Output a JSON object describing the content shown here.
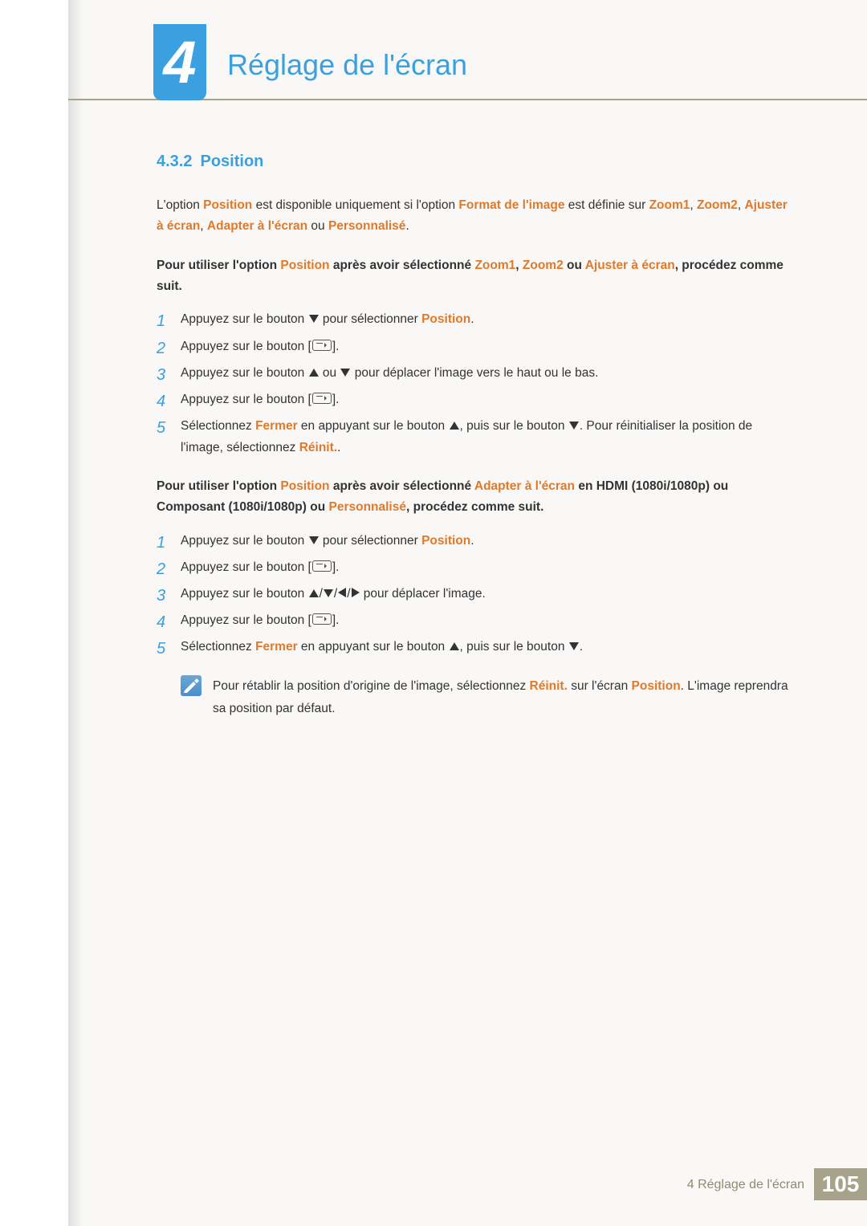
{
  "chapter": {
    "number": "4",
    "title": "Réglage de l'écran"
  },
  "section": {
    "number": "4.3.2",
    "title": "Position"
  },
  "intro": {
    "p1a": "L'option ",
    "p1b": "Position",
    "p1c": " est disponible uniquement si l'option ",
    "p1d": "Format de l'image",
    "p1e": " est définie sur ",
    "p1f": "Zoom1",
    "p1g": ", ",
    "p1h": "Zoom2",
    "p1i": ", ",
    "p1j": "Ajuster à écran",
    "p1k": ", ",
    "p1l": "Adapter à l'écran",
    "p1m": " ou ",
    "p1n": "Personnalisé",
    "p1o": "."
  },
  "lead1": {
    "a": "Pour utiliser l'option ",
    "b": "Position",
    "c": " après avoir sélectionné ",
    "d": "Zoom1",
    "e": ", ",
    "f": "Zoom2",
    "g": " ou ",
    "h": "Ajuster à écran",
    "i": ", procédez comme suit."
  },
  "steps1": {
    "n1": "1",
    "n2": "2",
    "n3": "3",
    "n4": "4",
    "n5": "5",
    "s1a": "Appuyez sur le bouton ",
    "s1b": " pour sélectionner ",
    "s1c": "Position",
    "s1d": ".",
    "s2a": "Appuyez sur le bouton [",
    "s2b": "].",
    "s3a": "Appuyez sur le bouton ",
    "s3b": " ou ",
    "s3c": " pour déplacer l'image vers le haut ou le bas.",
    "s4a": "Appuyez sur le bouton [",
    "s4b": "].",
    "s5a": "Sélectionnez ",
    "s5b": "Fermer",
    "s5c": " en appuyant sur le bouton ",
    "s5d": ", puis sur le bouton ",
    "s5e": ". Pour réinitialiser la position de l'image, sélectionnez ",
    "s5f": "Réinit.",
    "s5g": "."
  },
  "lead2": {
    "a": "Pour utiliser l'option ",
    "b": "Position",
    "c": " après avoir sélectionné ",
    "d": "Adapter à l'écran",
    "e": " en HDMI (1080i/1080p) ou Composant (1080i/1080p) ou ",
    "f": "Personnalisé",
    "g": ", procédez comme suit."
  },
  "steps2": {
    "n1": "1",
    "n2": "2",
    "n3": "3",
    "n4": "4",
    "n5": "5",
    "s1a": "Appuyez sur le bouton ",
    "s1b": " pour sélectionner ",
    "s1c": "Position",
    "s1d": ".",
    "s2a": "Appuyez sur le bouton [",
    "s2b": "].",
    "s3a": "Appuyez sur le bouton ",
    "s3b": " pour déplacer l'image.",
    "s4a": "Appuyez sur le bouton [",
    "s4b": "].",
    "s5a": "Sélectionnez ",
    "s5b": "Fermer",
    "s5c": " en appuyant sur le bouton ",
    "s5d": ", puis sur le bouton ",
    "s5e": "."
  },
  "note": {
    "a": "Pour rétablir la position d'origine de l'image, sélectionnez ",
    "b": "Réinit.",
    "c": " sur l'écran ",
    "d": "Position",
    "e": ". L'image reprendra sa position par défaut."
  },
  "footer": {
    "title": "4 Réglage de l'écran",
    "page": "105"
  }
}
